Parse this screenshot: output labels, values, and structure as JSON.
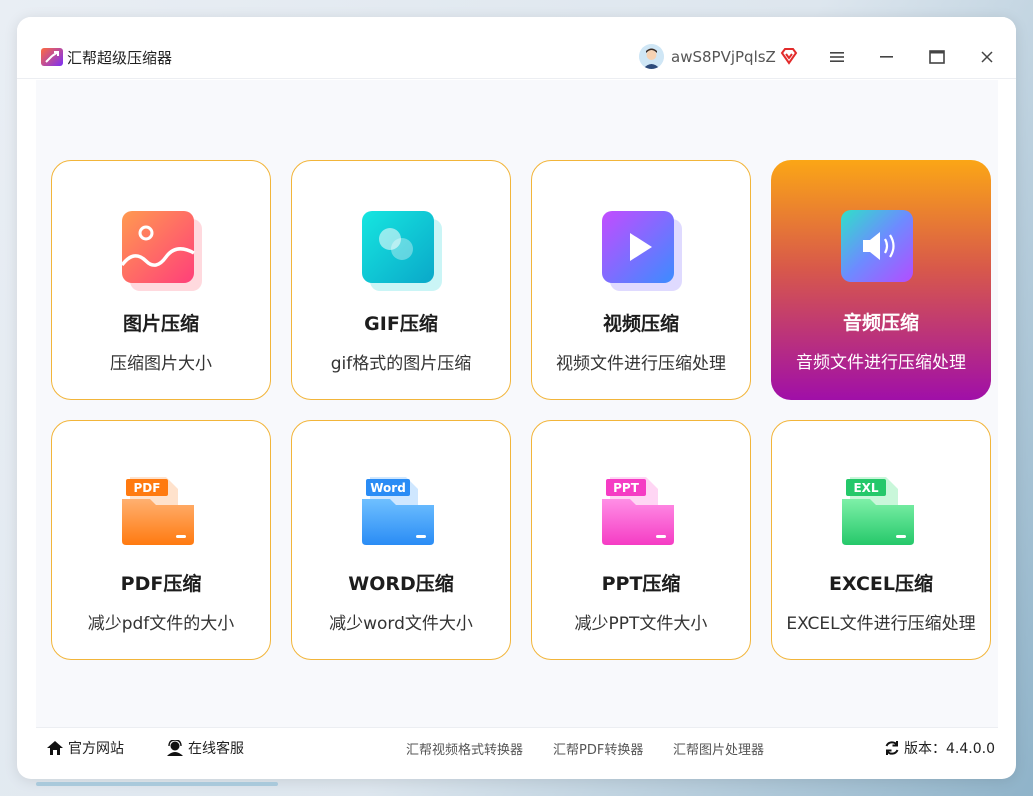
{
  "app": {
    "title": "汇帮超级压缩器",
    "username": "awS8PVjPqlsZ"
  },
  "colors": {
    "accent_border": "#f2b53a",
    "active_gradient_top": "#fba616",
    "active_gradient_bottom": "#a00fa8"
  },
  "cards": [
    {
      "title": "图片压缩",
      "desc": "压缩图片大小",
      "icon": "image-icon",
      "active": false
    },
    {
      "title": "GIF压缩",
      "desc": "gif格式的图片压缩",
      "icon": "gif-icon",
      "active": false
    },
    {
      "title": "视频压缩",
      "desc": "视频文件进行压缩处理",
      "icon": "video-play-icon",
      "active": false
    },
    {
      "title": "音频压缩",
      "desc": "音频文件进行压缩处理",
      "icon": "speaker-icon",
      "active": true
    },
    {
      "title": "PDF压缩",
      "desc": "减少pdf文件的大小",
      "icon": "pdf-folder-icon",
      "badge": "PDF",
      "active": false
    },
    {
      "title": "WORD压缩",
      "desc": "减少word文件大小",
      "icon": "word-folder-icon",
      "badge": "Word",
      "active": false
    },
    {
      "title": "PPT压缩",
      "desc": "减少PPT文件大小",
      "icon": "ppt-folder-icon",
      "badge": "PPT",
      "active": false
    },
    {
      "title": "EXCEL压缩",
      "desc": "EXCEL文件进行压缩处理",
      "icon": "excel-folder-icon",
      "badge": "EXL",
      "active": false
    }
  ],
  "footer": {
    "website": "官方网站",
    "support": "在线客服",
    "links": [
      "汇帮视频格式转换器",
      "汇帮PDF转换器",
      "汇帮图片处理器"
    ],
    "version": "版本：4.4.0.0"
  }
}
